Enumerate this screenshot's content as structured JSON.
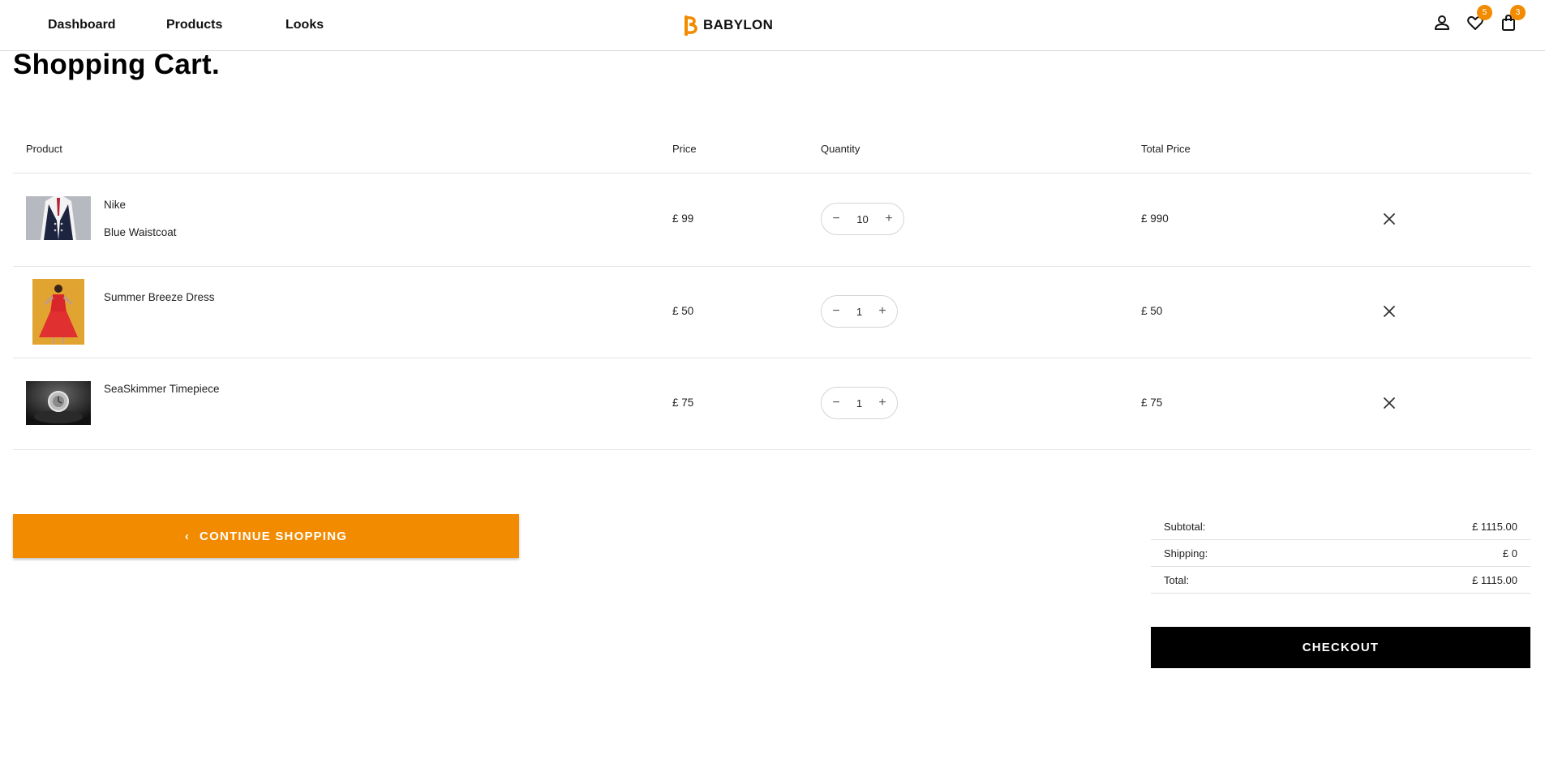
{
  "nav": {
    "links": [
      "Dashboard",
      "Products",
      "Looks"
    ],
    "brand": "BABYLON",
    "wishlist_count": "5",
    "cart_count": "3",
    "accent_color": "#f28b00"
  },
  "page": {
    "title": "Shopping Cart."
  },
  "table": {
    "headers": {
      "product": "Product",
      "price": "Price",
      "quantity": "Quantity",
      "total": "Total Price"
    },
    "rows": [
      {
        "brand": "Nike",
        "name": "Blue Waistcoat",
        "price": "£ 99",
        "quantity": "10",
        "total": "£ 990",
        "image_icon": "waistcoat-image"
      },
      {
        "name": "Summer Breeze Dress",
        "price": "£ 50",
        "quantity": "1",
        "total": "£ 50",
        "image_icon": "dress-image"
      },
      {
        "name": "SeaSkimmer Timepiece",
        "price": "£ 75",
        "quantity": "1",
        "total": "£ 75",
        "image_icon": "watch-image"
      }
    ]
  },
  "actions": {
    "continue_label": "CONTINUE SHOPPING",
    "checkout_label": "CHECKOUT"
  },
  "summary": {
    "subtotal_label": "Subtotal:",
    "subtotal_value": "£ 1115.00",
    "shipping_label": "Shipping:",
    "shipping_value": "£ 0",
    "total_label": "Total:",
    "total_value": "£ 1115.00"
  }
}
